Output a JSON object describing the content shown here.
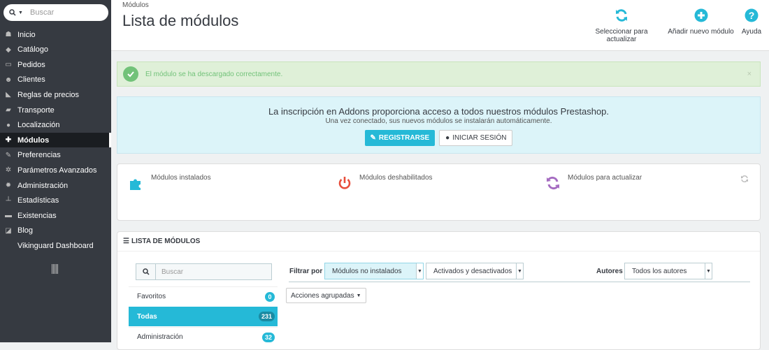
{
  "sidebar": {
    "search_placeholder": "Buscar",
    "items": [
      {
        "label": "Inicio",
        "icon": "dashboard-icon",
        "glyph": "☗"
      },
      {
        "label": "Catálogo",
        "icon": "catalog-icon",
        "glyph": "◆"
      },
      {
        "label": "Pedidos",
        "icon": "credit-card-icon",
        "glyph": "▭"
      },
      {
        "label": "Clientes",
        "icon": "users-icon",
        "glyph": "☻"
      },
      {
        "label": "Reglas de precios",
        "icon": "tag-icon",
        "glyph": "◣"
      },
      {
        "label": "Transporte",
        "icon": "truck-icon",
        "glyph": "▰"
      },
      {
        "label": "Localización",
        "icon": "globe-icon",
        "glyph": "●"
      },
      {
        "label": "Módulos",
        "icon": "puzzle-icon",
        "glyph": "✚"
      },
      {
        "label": "Preferencias",
        "icon": "wrench-icon",
        "glyph": "✎"
      },
      {
        "label": "Parámetros Avanzados",
        "icon": "cogs-icon",
        "glyph": "✲"
      },
      {
        "label": "Administración",
        "icon": "cog-icon",
        "glyph": "✹"
      },
      {
        "label": "Estadísticas",
        "icon": "bar-chart-icon",
        "glyph": "┴"
      },
      {
        "label": "Existencias",
        "icon": "archive-icon",
        "glyph": "▬"
      },
      {
        "label": "Blog",
        "icon": "edit-icon",
        "glyph": "◪"
      },
      {
        "label": "Vikinguard Dashboard",
        "icon": "",
        "glyph": ""
      }
    ],
    "active_index": 7
  },
  "header": {
    "breadcrumb": "Módulos",
    "title": "Lista de módulos",
    "toolbar": {
      "update_label": "Seleccionar para actualizar",
      "add_label": "Añadir nuevo módulo",
      "help_label": "Ayuda"
    }
  },
  "alert": {
    "message": "El módulo se ha descargado correctamente.",
    "close": "×"
  },
  "addons": {
    "headline": "La inscripción en Addons proporciona acceso a todos nuestros módulos Prestashop.",
    "subline": "Una vez conectado, sus nuevos módulos se instalarán automáticamente.",
    "register_label": "REGISTRARSE",
    "login_label": "INICIAR SESIÓN"
  },
  "stats": {
    "installed_label": "Módulos instalados",
    "disabled_label": "Módulos deshabilitados",
    "to_update_label": "Módulos para actualizar"
  },
  "modules_panel": {
    "title": "LISTA DE MÓDULOS",
    "search_placeholder": "Buscar",
    "categories": [
      {
        "label": "Favoritos",
        "count": "0"
      },
      {
        "label": "Todas",
        "count": "231"
      },
      {
        "label": "Administración",
        "count": "32"
      }
    ],
    "active_category": 1,
    "filter_label": "Filtrar por",
    "filter_install": "Módulos no instalados",
    "filter_status": "Activados y desactivados",
    "authors_label": "Autores",
    "authors_value": "Todos los autores",
    "bulk_label": "Acciones agrupadas"
  },
  "colors": {
    "sidebar_bg": "#363a41",
    "accent": "#25b9d7",
    "success": "#72c279",
    "danger": "#e84e3c",
    "purple": "#a56cc1"
  }
}
